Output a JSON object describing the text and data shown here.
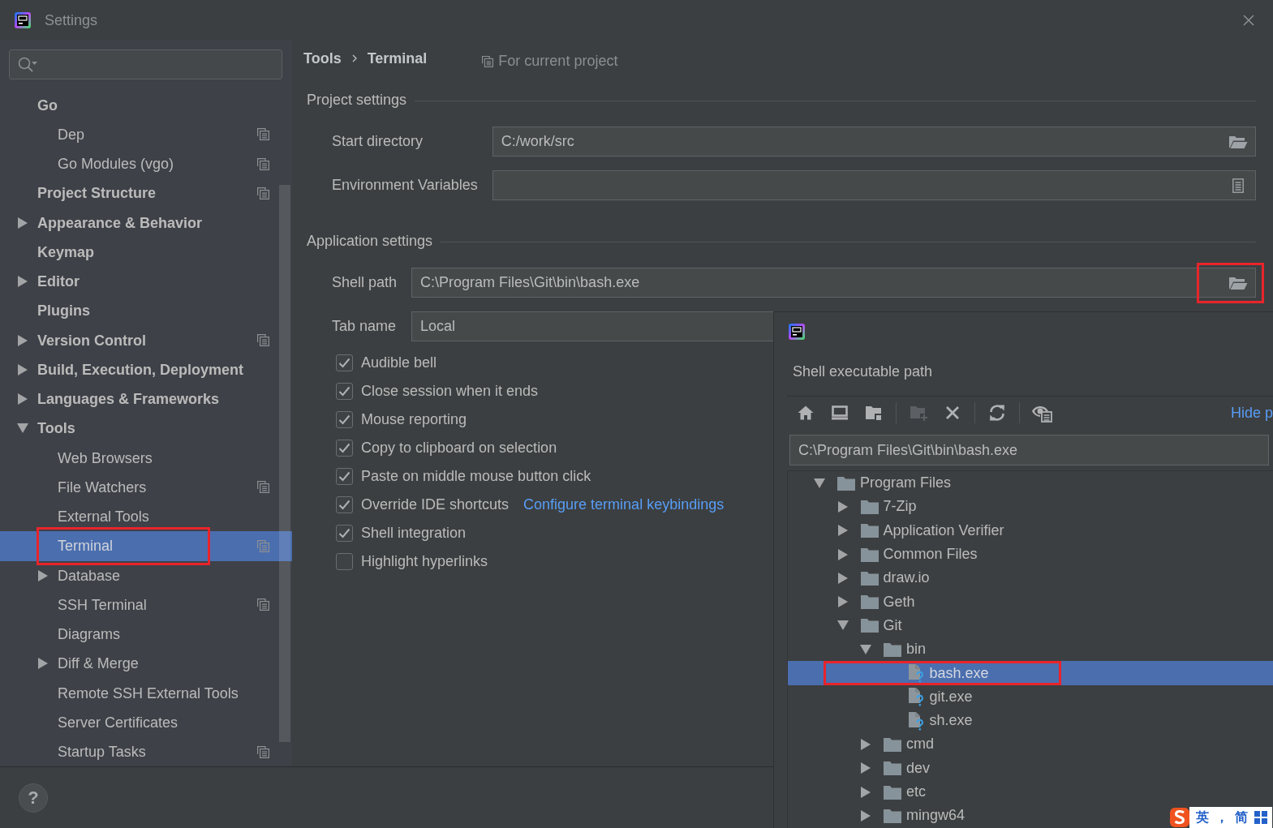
{
  "window": {
    "title": "Settings"
  },
  "sidebar": {
    "items": [
      {
        "label": "Go",
        "selected": false,
        "children": [
          {
            "label": "Dep",
            "selected": false,
            "project_level": true
          },
          {
            "label": "Go Modules (vgo)",
            "selected": false,
            "project_level": true
          }
        ]
      },
      {
        "label": "Project Structure",
        "selected": false,
        "project_level": true
      },
      {
        "label": "Appearance & Behavior",
        "selected": false,
        "expanded": false
      },
      {
        "label": "Keymap",
        "selected": false
      },
      {
        "label": "Editor",
        "selected": false,
        "expanded": false
      },
      {
        "label": "Plugins",
        "selected": false
      },
      {
        "label": "Version Control",
        "selected": false,
        "expanded": false,
        "project_level": true
      },
      {
        "label": "Build, Execution, Deployment",
        "selected": false,
        "expanded": false
      },
      {
        "label": "Languages & Frameworks",
        "selected": false,
        "expanded": false
      },
      {
        "label": "Tools",
        "selected": false,
        "expanded": true,
        "children": [
          {
            "label": "Web Browsers",
            "selected": false
          },
          {
            "label": "File Watchers",
            "selected": false,
            "project_level": true
          },
          {
            "label": "External Tools",
            "selected": false
          },
          {
            "label": "Terminal",
            "selected": true,
            "project_level": true,
            "highlighted": true
          },
          {
            "label": "Database",
            "selected": false,
            "expanded": false
          },
          {
            "label": "SSH Terminal",
            "selected": false,
            "project_level": true
          },
          {
            "label": "Diagrams",
            "selected": false
          },
          {
            "label": "Diff & Merge",
            "selected": false,
            "expanded": false
          },
          {
            "label": "Remote SSH External Tools",
            "selected": false
          },
          {
            "label": "Server Certificates",
            "selected": false
          },
          {
            "label": "Startup Tasks",
            "selected": false,
            "project_level": true
          }
        ]
      }
    ]
  },
  "breadcrumb": [
    "Tools",
    "Terminal"
  ],
  "scope_note": "For current project",
  "sections": [
    {
      "title": "Project settings",
      "fields": [
        {
          "label": "Start directory",
          "kind": "path",
          "value": "C:/work/src"
        },
        {
          "label": "Environment Variables",
          "kind": "env"
        }
      ]
    },
    {
      "title": "Application settings",
      "fields": [
        {
          "label": "Shell path",
          "kind": "path",
          "value": "C:\\Program Files\\Git\\bin\\bash.exe",
          "button_highlighted": true
        },
        {
          "label": "Tab name",
          "kind": "text",
          "value": "Local"
        }
      ],
      "options": [
        {
          "label": "Audible bell",
          "checked": true
        },
        {
          "label": "Close session when it ends",
          "checked": true
        },
        {
          "label": "Mouse reporting",
          "checked": true
        },
        {
          "label": "Copy to clipboard on selection",
          "checked": true
        },
        {
          "label": "Paste on middle mouse button click",
          "checked": true
        },
        {
          "label": "Override IDE shortcuts",
          "checked": true,
          "link": "Configure terminal keybindings"
        },
        {
          "label": "Shell integration",
          "checked": true
        },
        {
          "label": "Highlight hyperlinks",
          "checked": false
        }
      ]
    }
  ],
  "dialog": {
    "title": "Shell executable path",
    "toolbar": [
      [
        {
          "kind": "home",
          "disabled": false
        },
        {
          "kind": "desktop",
          "disabled": false
        },
        {
          "kind": "project",
          "disabled": false
        }
      ],
      [
        {
          "kind": "new_folder",
          "disabled": true
        },
        {
          "kind": "delete",
          "disabled": false
        }
      ],
      [
        {
          "kind": "refresh",
          "disabled": false
        }
      ],
      [
        {
          "kind": "show_hidden",
          "disabled": false
        }
      ]
    ],
    "hide_link": "Hide p",
    "path": "C:\\Program Files\\Git\\bin\\bash.exe",
    "tree": [
      {
        "name": "Program Files",
        "kind": "folder",
        "expanded": true,
        "selected": false,
        "children": [
          {
            "name": "7-Zip",
            "kind": "folder",
            "expanded": false,
            "selected": false
          },
          {
            "name": "Application Verifier",
            "kind": "folder",
            "expanded": false,
            "selected": false
          },
          {
            "name": "Common Files",
            "kind": "folder",
            "expanded": false,
            "selected": false
          },
          {
            "name": "draw.io",
            "kind": "folder",
            "expanded": false,
            "selected": false
          },
          {
            "name": "Geth",
            "kind": "folder",
            "expanded": false,
            "selected": false
          },
          {
            "name": "Git",
            "kind": "folder",
            "expanded": true,
            "selected": false,
            "children": [
              {
                "name": "bin",
                "kind": "folder",
                "expanded": true,
                "selected": false,
                "children": [
                  {
                    "name": "bash.exe",
                    "kind": "file",
                    "selected": true,
                    "highlighted": true
                  },
                  {
                    "name": "git.exe",
                    "kind": "file",
                    "selected": false
                  },
                  {
                    "name": "sh.exe",
                    "kind": "file",
                    "selected": false
                  }
                ]
              },
              {
                "name": "cmd",
                "kind": "folder",
                "expanded": false,
                "selected": false
              },
              {
                "name": "dev",
                "kind": "folder",
                "expanded": false,
                "selected": false
              },
              {
                "name": "etc",
                "kind": "folder",
                "expanded": false,
                "selected": false
              },
              {
                "name": "mingw64",
                "kind": "folder",
                "expanded": false,
                "selected": false
              }
            ]
          }
        ]
      }
    ]
  },
  "help_button": "?",
  "ime_toolbar": {
    "labels": [
      "英",
      "，",
      "简"
    ]
  }
}
